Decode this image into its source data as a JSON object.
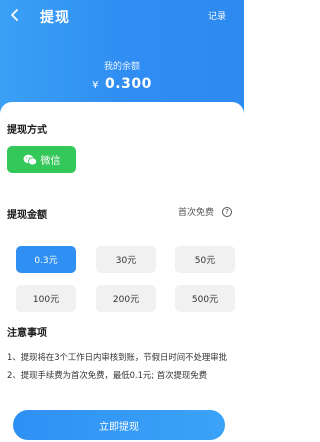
{
  "header": {
    "title": "提现",
    "record_label": "记录",
    "balance_label": "我的余额",
    "currency_symbol": "¥",
    "balance_value": "0.300"
  },
  "method": {
    "section_title": "提现方式",
    "wechat_label": "微信",
    "wechat_color": "#34c759"
  },
  "amount": {
    "section_title": "提现金额",
    "first_free": "首次免费",
    "help_icon": "?",
    "options": [
      "0.3元",
      "30元",
      "50元",
      "100元",
      "200元",
      "500元"
    ],
    "selected": "0.3元"
  },
  "notes": {
    "section_title": "注意事项",
    "items": [
      "1、提现将在3个工作日内审核到账，节假日时间不处理审批",
      "2、提现手续费为首次免费，最低0.1元; 首次提现免费"
    ]
  },
  "submit_label": "立即提现",
  "colors": {
    "accent": "#2f8ff2",
    "option_bg": "#f1f1f1"
  }
}
